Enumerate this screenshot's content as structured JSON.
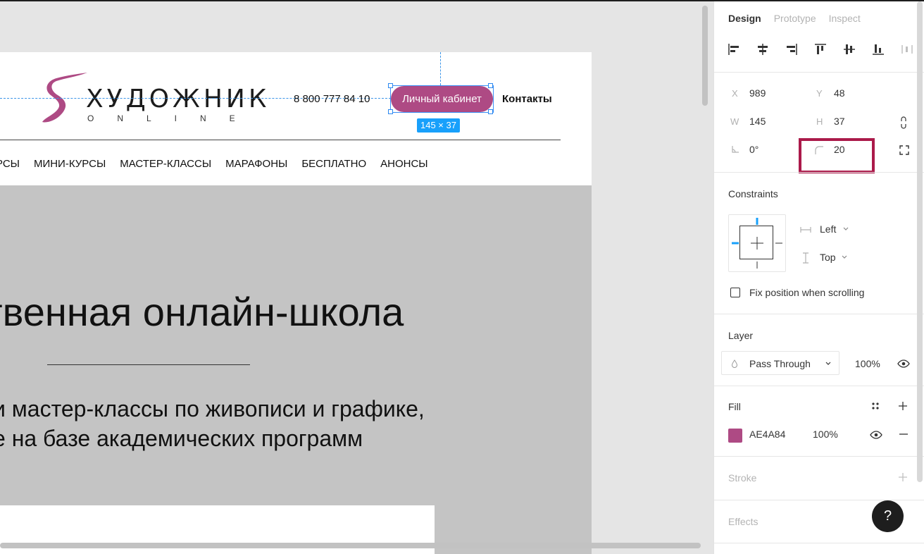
{
  "canvas": {
    "logo": {
      "word": "ХУДОЖНИК",
      "sub": "ONLINE",
      "brand_color": "#ae4a84"
    },
    "phone": "8 800 777 84 10",
    "cabinet_button": "Личный кабинет",
    "size_badge": "145 × 37",
    "contacts": "Контакты",
    "nav": [
      "РСЫ",
      "МИНИ-КУРСЫ",
      "МАСТЕР-КЛАССЫ",
      "МАРАФОНЫ",
      "БЕСПЛАТНО",
      "АНОНСЫ"
    ],
    "hero_title": "твенная онлайн-школа",
    "hero_sub_1": "и мастер-классы по живописи и графике,",
    "hero_sub_2": "е на базе академических программ"
  },
  "panel": {
    "tabs": [
      "Design",
      "Prototype",
      "Inspect"
    ],
    "active_tab": "Design",
    "x_label": "X",
    "x": "989",
    "y_label": "Y",
    "y": "48",
    "w_label": "W",
    "w": "145",
    "h_label": "H",
    "h": "37",
    "rotation": "0°",
    "corner_radius": "20",
    "constraints_title": "Constraints",
    "constraint_h": "Left",
    "constraint_v": "Top",
    "fix_position": "Fix position when scrolling",
    "layer_title": "Layer",
    "blend_mode": "Pass Through",
    "layer_opacity": "100%",
    "fill_title": "Fill",
    "fill_hex": "AE4A84",
    "fill_opacity": "100%",
    "fill_color": "#ae4a84",
    "stroke_title": "Stroke",
    "effects_title": "Effects",
    "help": "?",
    "highlight_color": "#ab1a4a"
  }
}
